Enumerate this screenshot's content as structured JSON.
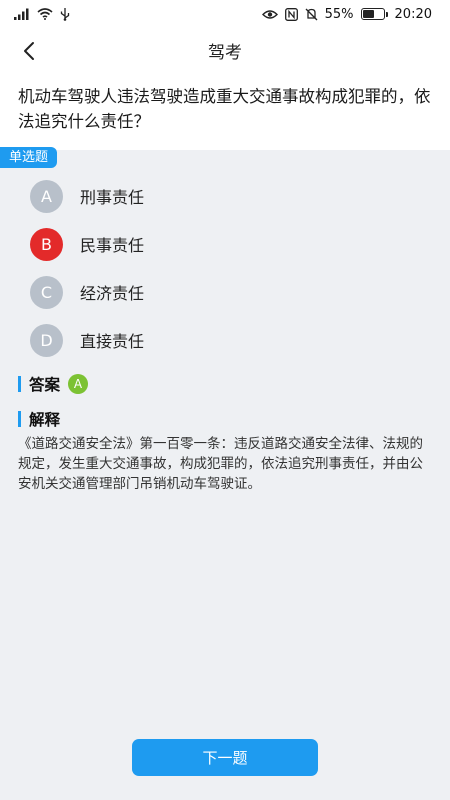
{
  "status_bar": {
    "battery": "55%",
    "time": "20:20"
  },
  "nav": {
    "title": "驾考"
  },
  "question": {
    "text": "机动车驾驶人违法驾驶造成重大交通事故构成犯罪的，依法追究什么责任？",
    "type_label": "单选题"
  },
  "options": [
    {
      "letter": "A",
      "text": "刑事责任",
      "state": "normal"
    },
    {
      "letter": "B",
      "text": "民事责任",
      "state": "wrong"
    },
    {
      "letter": "C",
      "text": "经济责任",
      "state": "normal"
    },
    {
      "letter": "D",
      "text": "直接责任",
      "state": "normal"
    }
  ],
  "answer": {
    "label": "答案",
    "value": "A"
  },
  "explanation": {
    "label": "解释",
    "text": "《道路交通安全法》第一百零一条：违反道路交通安全法律、法规的规定，发生重大交通事故，构成犯罪的，依法追究刑事责任，并由公安机关交通管理部门吊销机动车驾驶证。"
  },
  "next_button": {
    "label": "下一题"
  },
  "colors": {
    "accent": "#1e9bf0",
    "wrong": "#e32a2a",
    "correct": "#7cc233",
    "option_default": "#b8c0ca"
  }
}
